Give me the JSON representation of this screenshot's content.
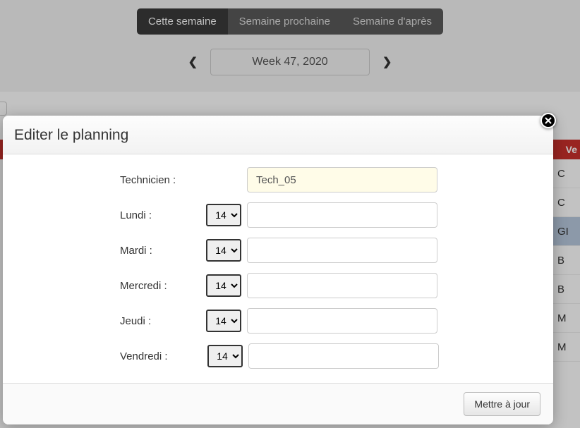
{
  "tabs": {
    "this_week": "Cette semaine",
    "next_week": "Semaine prochaine",
    "week_after": "Semaine d'après"
  },
  "week_picker": {
    "label": "Week 47, 2020"
  },
  "bg_table": {
    "col_header": "Ve",
    "rows": [
      "C",
      "C",
      "GI",
      "B",
      "B",
      "M",
      "M"
    ]
  },
  "modal": {
    "title": "Editer le planning",
    "technician_label": "Technicien :",
    "technician_value": "Tech_05",
    "days": [
      {
        "label": "Lundi :",
        "select": "14",
        "text": ""
      },
      {
        "label": "Mardi :",
        "select": "14",
        "text": ""
      },
      {
        "label": "Mercredi :",
        "select": "14",
        "text": ""
      },
      {
        "label": "Jeudi :",
        "select": "14",
        "text": ""
      },
      {
        "label": "Vendredi :",
        "select": "14",
        "text": ""
      }
    ],
    "submit": "Mettre à jour"
  }
}
